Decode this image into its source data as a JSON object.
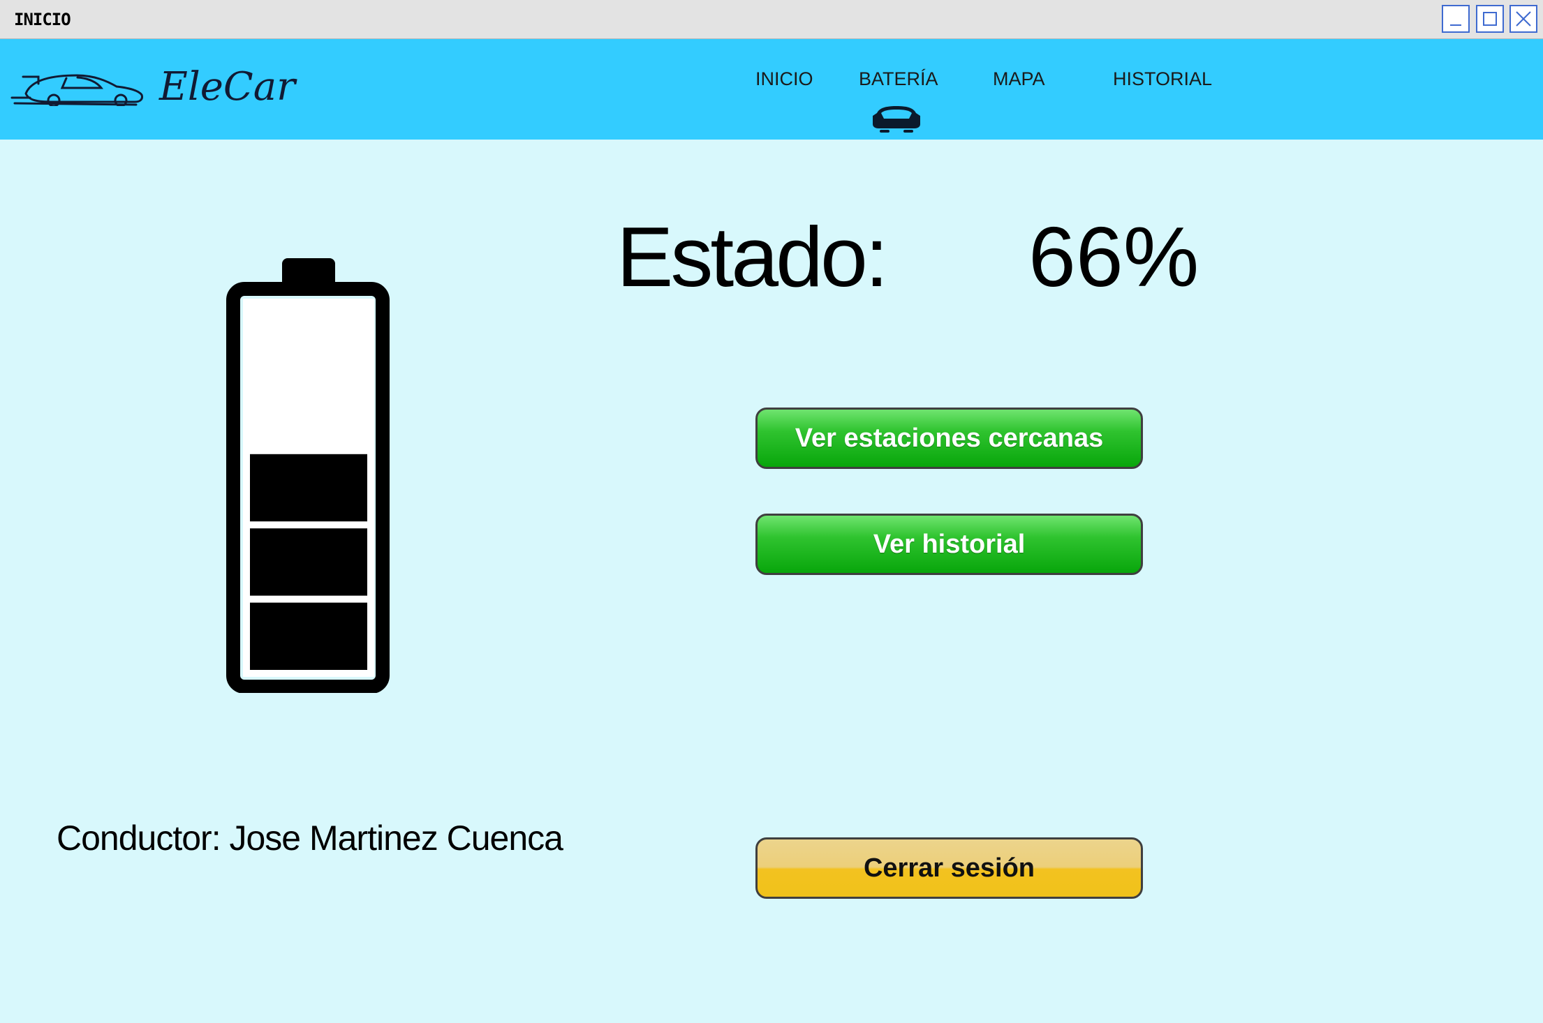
{
  "window": {
    "title": "INICIO",
    "controls": [
      "minimize-icon",
      "maximize-icon",
      "close-icon"
    ]
  },
  "brand": {
    "name": "EleCar",
    "logo_icon": "sports-car-icon"
  },
  "nav": {
    "items": [
      {
        "label": "INICIO"
      },
      {
        "label": "BATERÍA",
        "active": true,
        "indicator_icon": "car-front-icon"
      },
      {
        "label": "MAPA"
      },
      {
        "label": "HISTORIAL"
      }
    ]
  },
  "battery": {
    "icon": "battery-icon",
    "filled_bars": 3,
    "total_bars": 5
  },
  "status": {
    "label": "Estado:",
    "value": "66%"
  },
  "actions": {
    "stations": "Ver estaciones cercanas",
    "history": "Ver historial",
    "logout": "Cerrar sesión"
  },
  "driver": {
    "text": "Conductor: Jose Martinez Cuenca"
  },
  "colors": {
    "navbar": "#33ccff",
    "background": "#d8f8fc",
    "button_green": "#08a60b",
    "button_yellow": "#f3c220"
  }
}
